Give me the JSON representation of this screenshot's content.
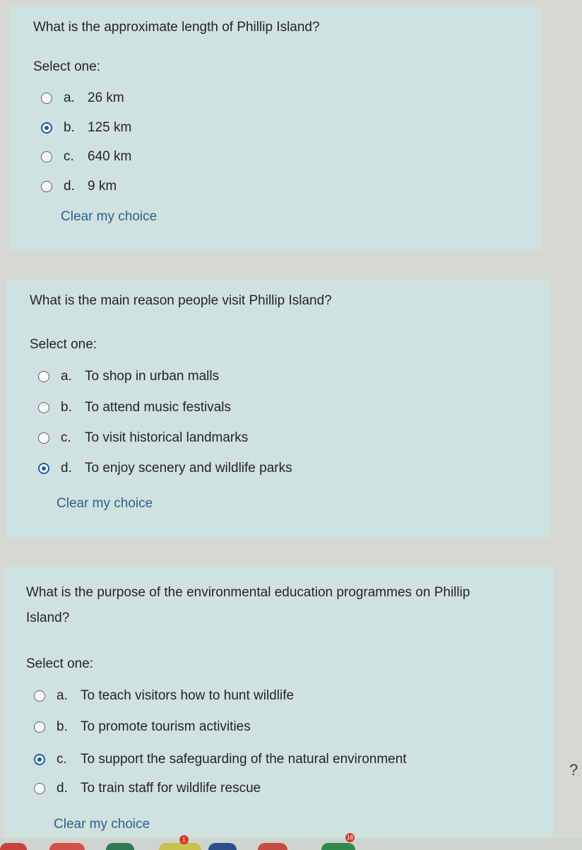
{
  "questions": [
    {
      "prompt": "What is the approximate length of Phillip Island?",
      "select_label": "Select one:",
      "options": [
        {
          "letter": "a.",
          "text": "26 km",
          "selected": false
        },
        {
          "letter": "b.",
          "text": "125 km",
          "selected": true
        },
        {
          "letter": "c.",
          "text": "640 km",
          "selected": false
        },
        {
          "letter": "d.",
          "text": "9 km",
          "selected": false
        }
      ],
      "clear_label": "Clear my choice"
    },
    {
      "prompt": "What is the main reason people visit Phillip Island?",
      "select_label": "Select one:",
      "options": [
        {
          "letter": "a.",
          "text": "To shop in urban malls",
          "selected": false
        },
        {
          "letter": "b.",
          "text": "To attend music festivals",
          "selected": false
        },
        {
          "letter": "c.",
          "text": "To visit historical landmarks",
          "selected": false
        },
        {
          "letter": "d.",
          "text": "To enjoy scenery and wildlife parks",
          "selected": true
        }
      ],
      "clear_label": "Clear my choice"
    },
    {
      "prompt_line1": "What is the purpose of the environmental education programmes on Phillip",
      "prompt_line2": "Island?",
      "select_label": "Select one:",
      "options": [
        {
          "letter": "a.",
          "text": "To teach visitors how to hunt wildlife",
          "selected": false
        },
        {
          "letter": "b.",
          "text": "To promote tourism activities",
          "selected": false
        },
        {
          "letter": "c.",
          "text": "To support the safeguarding of the natural environment",
          "selected": true
        },
        {
          "letter": "d.",
          "text": "To train staff for wildlife rescue",
          "selected": false
        }
      ],
      "clear_label": "Clear my choice"
    }
  ],
  "help_icon": "?",
  "taskbar": {
    "badge_1": "1",
    "badge_2": "18"
  },
  "colors": {
    "card": "#cfe2df",
    "selected_radio": "#1e5da8",
    "link": "#2d5f8f"
  }
}
